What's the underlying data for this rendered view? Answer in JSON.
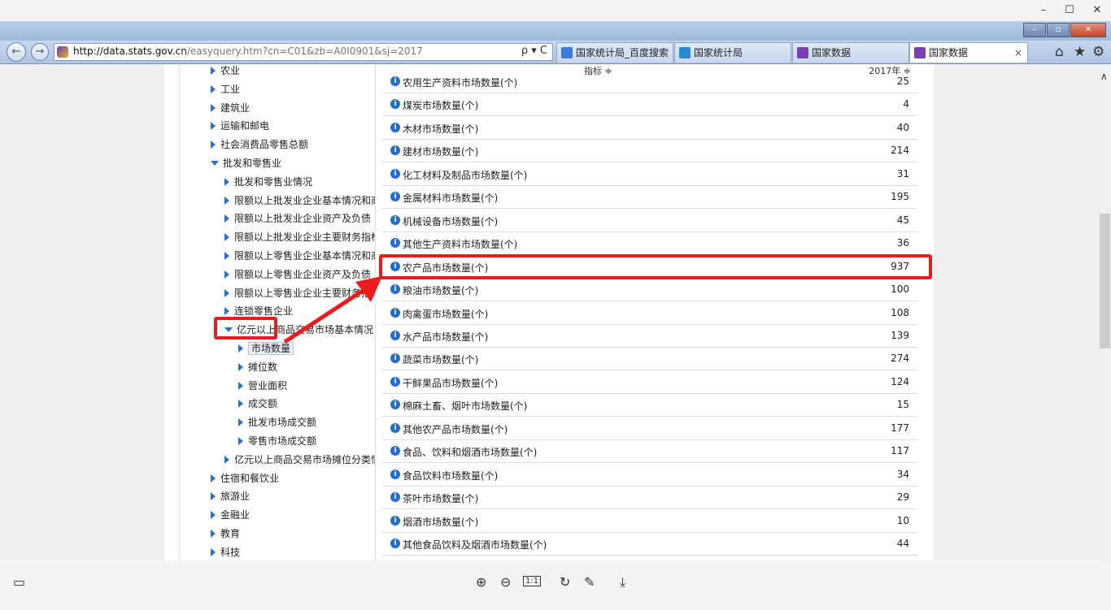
{
  "browser": {
    "url_host": "http://data.stats.gov.cn",
    "url_path": "/easyquery.htm?cn=C01&zb=A0I0901&sj=2017",
    "addr_tools": "ρ ▾ C",
    "tabs": [
      {
        "label": "国家统计局_百度搜索",
        "color": "#3b7be0"
      },
      {
        "label": "国家统计局",
        "color": "#2a8ad2"
      },
      {
        "label": "国家数据",
        "color": "#7a3fb3"
      },
      {
        "label": "国家数据",
        "color": "#7a3fb3",
        "close": "×"
      }
    ]
  },
  "tree": [
    {
      "label": "农业",
      "level": 0,
      "state": "collapsed"
    },
    {
      "label": "工业",
      "level": 0,
      "state": "collapsed"
    },
    {
      "label": "建筑业",
      "level": 0,
      "state": "collapsed"
    },
    {
      "label": "运输和邮电",
      "level": 0,
      "state": "collapsed"
    },
    {
      "label": "社会消费品零售总额",
      "level": 0,
      "state": "collapsed"
    },
    {
      "label": "批发和零售业",
      "level": 0,
      "state": "expanded"
    },
    {
      "label": "批发和零售业情况",
      "level": 1,
      "state": "collapsed"
    },
    {
      "label": "限额以上批发业企业基本情况和商品",
      "level": 1,
      "state": "collapsed"
    },
    {
      "label": "限额以上批发业企业资产及负债",
      "level": 1,
      "state": "collapsed"
    },
    {
      "label": "限额以上批发业企业主要财务指标",
      "level": 1,
      "state": "collapsed"
    },
    {
      "label": "限额以上零售业企业基本情况和商品",
      "level": 1,
      "state": "collapsed"
    },
    {
      "label": "限额以上零售业企业资产及负债",
      "level": 1,
      "state": "collapsed"
    },
    {
      "label": "限额以上零售业企业主要财务指标",
      "level": 1,
      "state": "collapsed"
    },
    {
      "label": "连锁零售企业",
      "level": 1,
      "state": "collapsed"
    },
    {
      "label": "亿元以上商品交易市场基本情况",
      "level": 1,
      "state": "expanded"
    },
    {
      "label": "市场数量",
      "level": 2,
      "state": "selected"
    },
    {
      "label": "摊位数",
      "level": 2,
      "state": "collapsed"
    },
    {
      "label": "营业面积",
      "level": 2,
      "state": "collapsed"
    },
    {
      "label": "成交额",
      "level": 2,
      "state": "collapsed"
    },
    {
      "label": "批发市场成交额",
      "level": 2,
      "state": "collapsed"
    },
    {
      "label": "零售市场成交额",
      "level": 2,
      "state": "collapsed"
    },
    {
      "label": "亿元以上商品交易市场摊位分类情况",
      "level": 1,
      "state": "collapsed"
    },
    {
      "label": "住宿和餐饮业",
      "level": 0,
      "state": "collapsed"
    },
    {
      "label": "旅游业",
      "level": 0,
      "state": "collapsed"
    },
    {
      "label": "金融业",
      "level": 0,
      "state": "collapsed"
    },
    {
      "label": "教育",
      "level": 0,
      "state": "collapsed"
    },
    {
      "label": "科技",
      "level": 0,
      "state": "collapsed"
    }
  ],
  "table": {
    "col_indicator": "指标 ≑",
    "col_year": "2017年 ≑",
    "info_glyph": "i",
    "rows": [
      {
        "name": "农用生产资料市场数量(个)",
        "value": "25"
      },
      {
        "name": "煤炭市场数量(个)",
        "value": "4"
      },
      {
        "name": "木材市场数量(个)",
        "value": "40"
      },
      {
        "name": "建材市场数量(个)",
        "value": "214"
      },
      {
        "name": "化工材料及制品市场数量(个)",
        "value": "31"
      },
      {
        "name": "金属材料市场数量(个)",
        "value": "195"
      },
      {
        "name": "机械设备市场数量(个)",
        "value": "45"
      },
      {
        "name": "其他生产资料市场数量(个)",
        "value": "36"
      },
      {
        "name": "农产品市场数量(个)",
        "value": "937"
      },
      {
        "name": "粮油市场数量(个)",
        "value": "100"
      },
      {
        "name": "肉禽蛋市场数量(个)",
        "value": "108"
      },
      {
        "name": "水产品市场数量(个)",
        "value": "139"
      },
      {
        "name": "蔬菜市场数量(个)",
        "value": "274"
      },
      {
        "name": "干鲜果品市场数量(个)",
        "value": "124"
      },
      {
        "name": "棉麻土畜、烟叶市场数量(个)",
        "value": "15"
      },
      {
        "name": "其他农产品市场数量(个)",
        "value": "177"
      },
      {
        "name": "食品、饮料和烟酒市场数量(个)",
        "value": "117"
      },
      {
        "name": "食品饮料市场数量(个)",
        "value": "34"
      },
      {
        "name": "茶叶市场数量(个)",
        "value": "29"
      },
      {
        "name": "烟酒市场数量(个)",
        "value": "10"
      },
      {
        "name": "其他食品饮料及烟酒市场数量(个)",
        "value": "44"
      }
    ]
  },
  "viewer": {
    "win_min": "–",
    "win_max": "☐",
    "win_close": "✕",
    "tools": {
      "zoom_in": "⊕",
      "zoom_out": "⊖",
      "fit": "1:1",
      "rotate": "↻",
      "edit": "✎",
      "download": "⤓",
      "thumbs": "▭"
    }
  },
  "colors": {
    "highlight": "#ec1c1c",
    "tree_arrow": "#2a6fd6",
    "info_icon": "#1f6fd0"
  }
}
